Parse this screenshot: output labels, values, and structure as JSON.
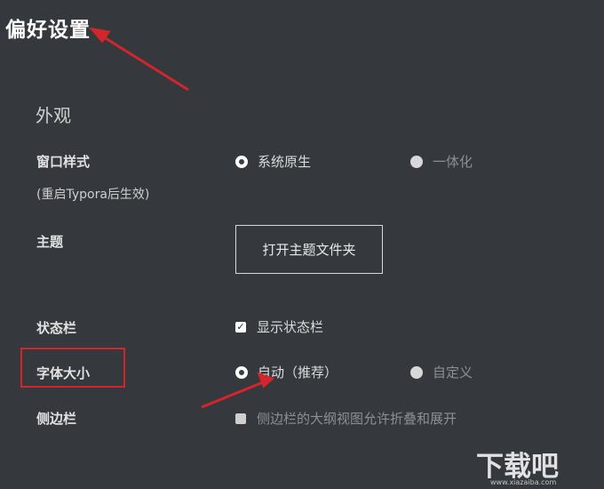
{
  "page_title": "偏好设置",
  "section_title": "外观",
  "window_style": {
    "label": "窗口样式",
    "note": "(重启Typora后生效)",
    "options": [
      "系统原生",
      "一体化"
    ],
    "selected": "系统原生"
  },
  "theme": {
    "label": "主题",
    "button_label": "打开主题文件夹"
  },
  "status_bar": {
    "label": "状态栏",
    "checkbox_label": "显示状态栏",
    "checked": true
  },
  "font_size": {
    "label": "字体大小",
    "options": [
      "自动（推荐）",
      "自定义"
    ],
    "selected": "自动（推荐）"
  },
  "sidebar": {
    "label": "侧边栏",
    "checkbox_label": "侧边栏的大纲视图允许折叠和展开",
    "checked": false
  },
  "watermark": {
    "text": "下载吧",
    "url": "www.xiazaiba.com"
  },
  "colors": {
    "background": "#35383c",
    "annotation_red": "#d3262c"
  }
}
